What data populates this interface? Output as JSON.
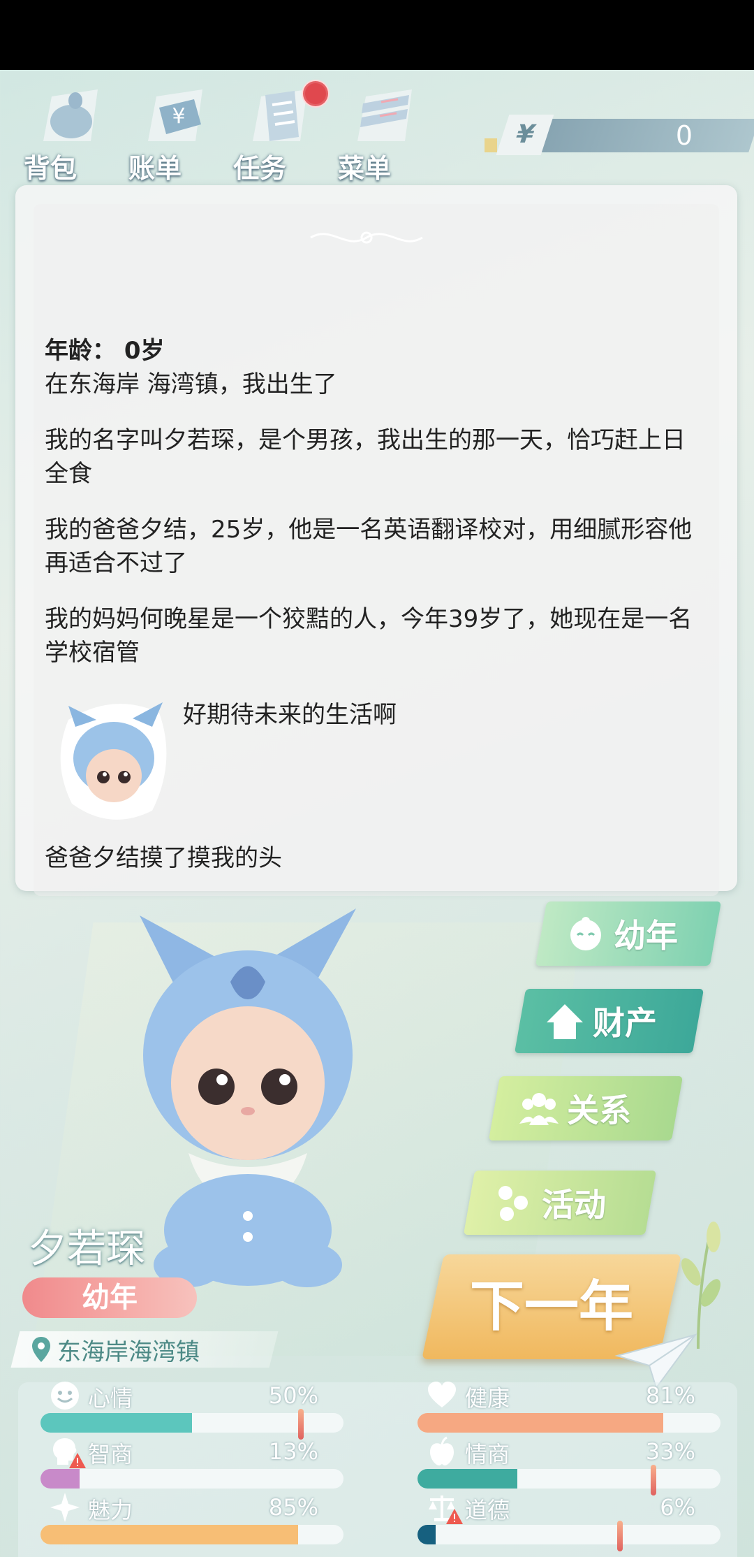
{
  "topbar": {
    "items": [
      {
        "label": "背包",
        "icon": "backpack-icon"
      },
      {
        "label": "账单",
        "icon": "bill-icon"
      },
      {
        "label": "任务",
        "icon": "task-icon",
        "has_notification": true
      },
      {
        "label": "菜单",
        "icon": "menu-icon"
      }
    ],
    "money": {
      "symbol": "¥",
      "value": "0"
    }
  },
  "story": {
    "age_line": "年龄： 0岁",
    "paragraphs": [
      "在东海岸 海湾镇，我出生了",
      "我的名字叫夕若琛，是个男孩，我出生的那一天，恰巧赶上日全食",
      "我的爸爸夕结，25岁，他是一名英语翻译校对，用细腻形容他再适合不过了",
      "我的妈妈何晚星是一个狡黠的人，今年39岁了，她现在是一名学校宿管"
    ],
    "avatar_quote": "好期待未来的生活啊",
    "event": "爸爸夕结摸了摸我的头"
  },
  "character": {
    "name": "夕若琛",
    "stage": "幼年",
    "location": "东海岸海湾镇"
  },
  "side_buttons": [
    {
      "label": "幼年",
      "icon": "baby-face-icon",
      "color": "#8fd4b0"
    },
    {
      "label": "财产",
      "icon": "house-icon",
      "color": "#5bbfa4"
    },
    {
      "label": "关系",
      "icon": "people-icon",
      "color": "#b9df93"
    },
    {
      "label": "活动",
      "icon": "activity-icon",
      "color": "#c6e29a"
    }
  ],
  "next_year": "下一年",
  "stats": [
    {
      "name": "心情",
      "value": "50%",
      "fill": 0.5,
      "icon": "smile-icon",
      "color": "#5cc6bd",
      "marker": 0.85,
      "warn": false
    },
    {
      "name": "健康",
      "value": "81%",
      "fill": 0.81,
      "icon": "heart-icon",
      "color": "#f6a882",
      "marker": null,
      "warn": false
    },
    {
      "name": "智商",
      "value": "13%",
      "fill": 0.13,
      "icon": "brain-icon",
      "color": "#c88ac9",
      "marker": null,
      "warn": true
    },
    {
      "name": "情商",
      "value": "33%",
      "fill": 0.33,
      "icon": "apple-icon",
      "color": "#3eab9f",
      "marker": 0.77,
      "warn": false
    },
    {
      "name": "魅力",
      "value": "85%",
      "fill": 0.85,
      "icon": "sparkle-icon",
      "color": "#f7be75",
      "marker": null,
      "warn": false
    },
    {
      "name": "道德",
      "value": "6%",
      "fill": 0.06,
      "icon": "scale-icon",
      "color": "#16607f",
      "marker": 0.66,
      "warn": true
    }
  ]
}
